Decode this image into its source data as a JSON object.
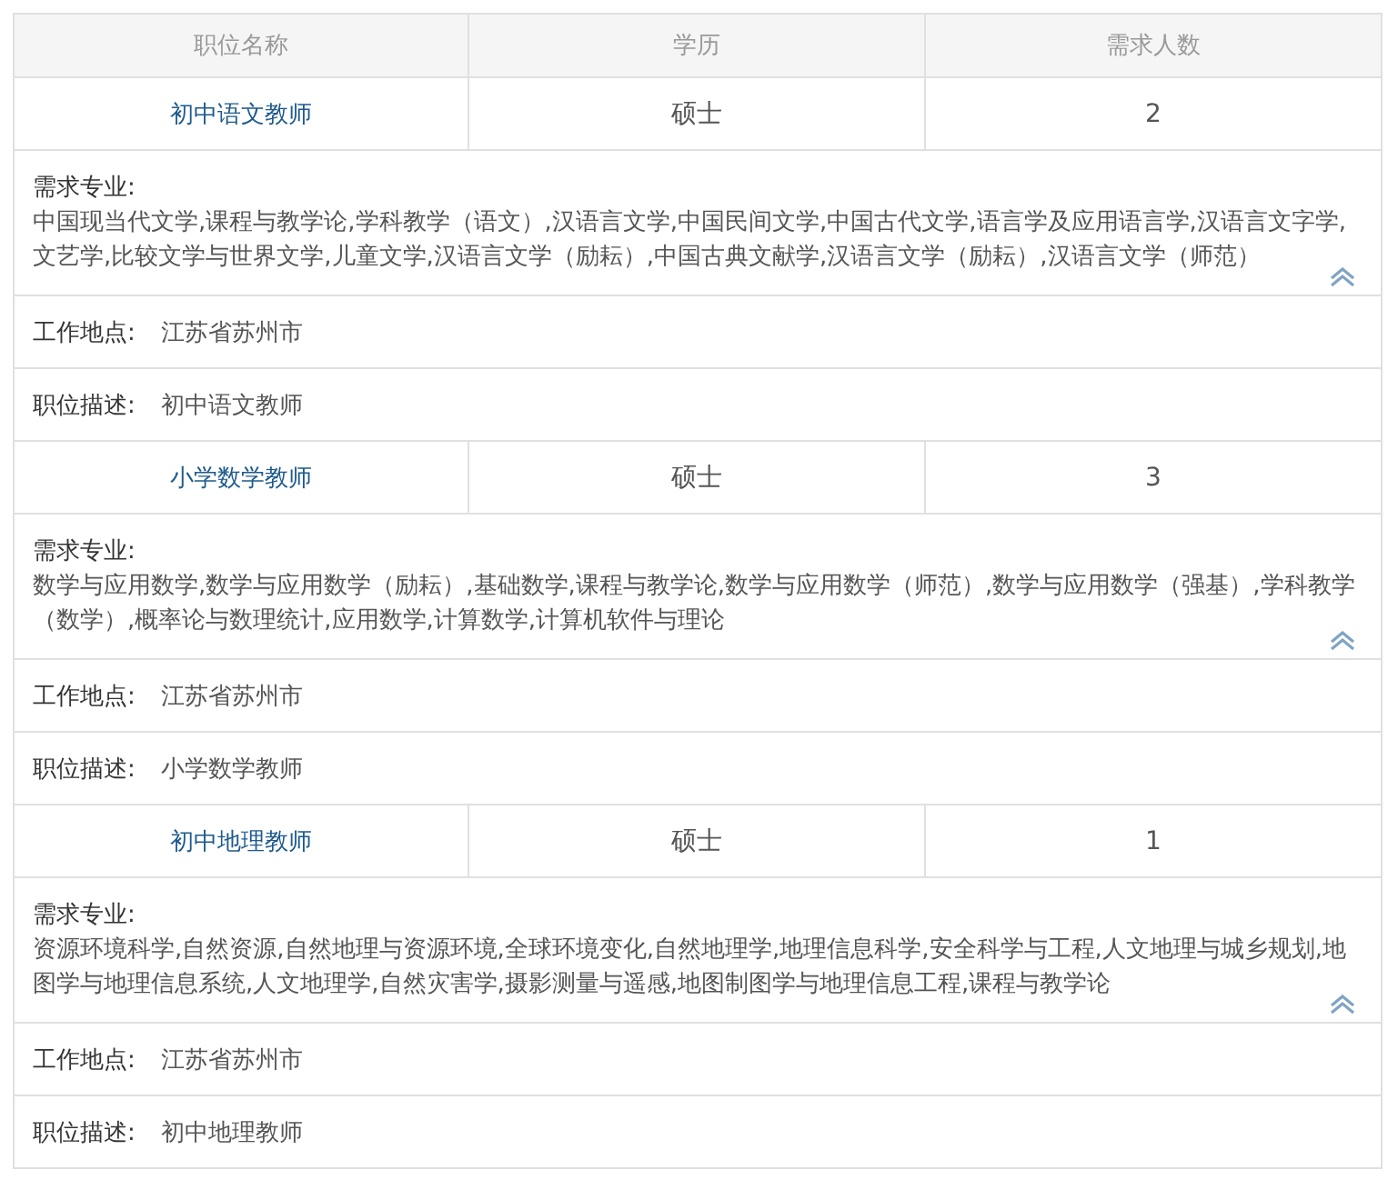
{
  "columns": [
    "职位名称",
    "学历",
    "需求人数"
  ],
  "positions": [
    {
      "title": "初中语文教师",
      "education": "硕士",
      "count": "2",
      "majors_label": "需求专业:",
      "majors": "中国现当代文学,课程与教学论,学科教学（语文）,汉语言文学,中国民间文学,中国古代文学,语言学及应用语言学,汉语言文字学,文艺学,比较文学与世界文学,儿童文学,汉语言文学（励耘）,中国古典文献学,汉语言文学（励耘）,汉语言文学（师范）",
      "expanded": true,
      "location_label": "工作地点:",
      "location": "江苏省苏州市",
      "description_label": "职位描述:",
      "description": "初中语文教师"
    },
    {
      "title": "小学数学教师",
      "education": "硕士",
      "count": "3",
      "majors_label": "需求专业:",
      "majors": "数学与应用数学,数学与应用数学（励耘）,基础数学,课程与教学论,数学与应用数学（师范）,数学与应用数学（强基）,学科教学（数学）,概率论与数理统计,应用数学,计算数学,计算机软件与理论",
      "expanded": true,
      "location_label": "工作地点:",
      "location": "江苏省苏州市",
      "description_label": "职位描述:",
      "description": "小学数学教师"
    },
    {
      "title": "初中地理教师",
      "education": "硕士",
      "count": "1",
      "majors_label": "需求专业:",
      "majors": "资源环境科学,自然资源,自然地理与资源环境,全球环境变化,自然地理学,地理信息科学,安全科学与工程,人文地理与城乡规划,地图学与地理信息系统,人文地理学,自然灾害学,摄影测量与遥感,地图制图学与地理信息工程,课程与教学论",
      "expanded": true,
      "location_label": "工作地点:",
      "location": "江苏省苏州市",
      "description_label": "职位描述:",
      "description": "初中地理教师"
    }
  ]
}
